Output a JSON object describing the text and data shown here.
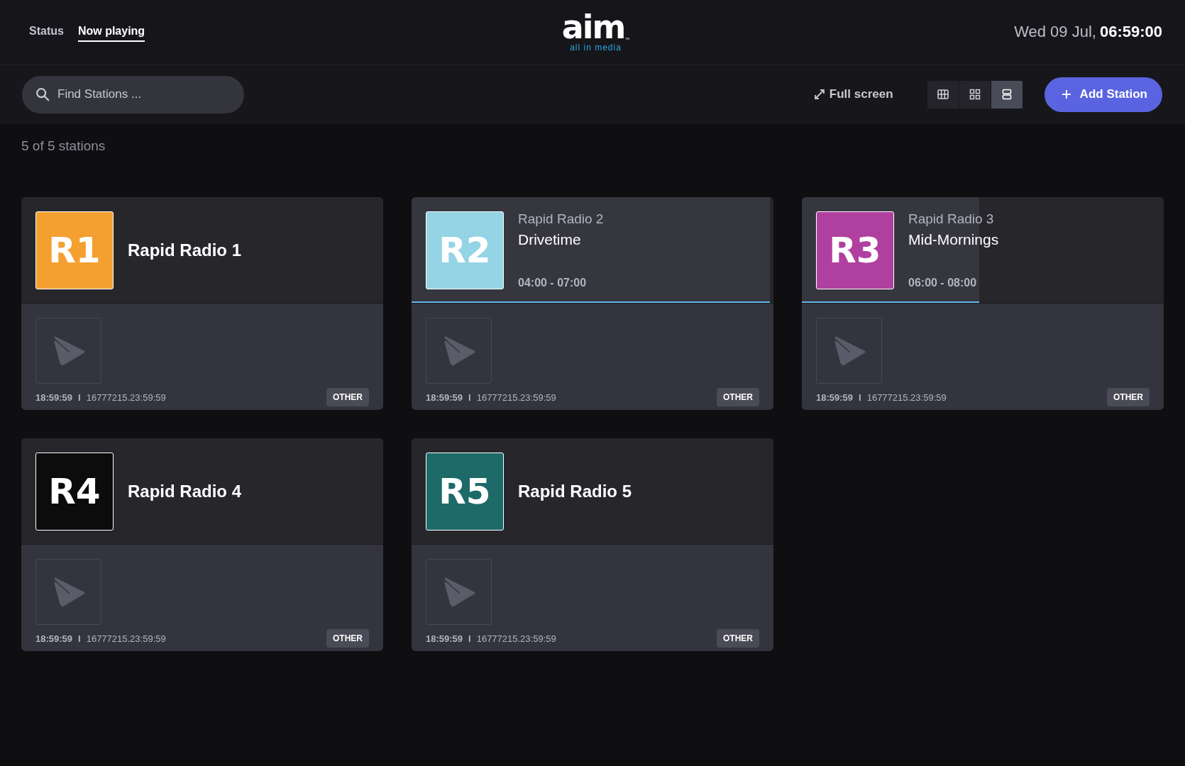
{
  "nav": {
    "tabs": [
      {
        "label": "Status",
        "selected": false
      },
      {
        "label": "Now playing",
        "selected": true
      }
    ]
  },
  "logo": {
    "wordmark": "aim",
    "trademark": "™",
    "tagline": "all in media"
  },
  "clock": {
    "date": "Wed 09 Jul,",
    "time": "06:59:00"
  },
  "toolbar": {
    "search": {
      "placeholder": "Find Stations ..."
    },
    "fullscreen": "Full screen",
    "views": [
      {
        "kind": "table",
        "selected": false
      },
      {
        "kind": "grid",
        "selected": false
      },
      {
        "kind": "list",
        "selected": true
      }
    ],
    "add_button": "Add Station"
  },
  "count": "5 of 5 stations",
  "stations": [
    {
      "badge": "R1",
      "color": "#f4a031",
      "name": "Rapid Radio 1",
      "footer_time": "18:59:59",
      "footer_sep": "I",
      "footer_duration": "16777215.23:59:59",
      "tag": "OTHER"
    },
    {
      "badge": "R2",
      "color": "#94d4e4",
      "name": "Rapid Radio 2",
      "show": {
        "title": "Drivetime",
        "hours": "04:00 - 07:00",
        "level": 0.99
      },
      "footer_time": "18:59:59",
      "footer_sep": "I",
      "footer_duration": "16777215.23:59:59",
      "tag": "OTHER"
    },
    {
      "badge": "R3",
      "color": "#b0409f",
      "name": "Rapid Radio 3",
      "show": {
        "title": "Mid-Mornings",
        "hours": "06:00 - 08:00",
        "level": 0.49
      },
      "footer_time": "18:59:59",
      "footer_sep": "I",
      "footer_duration": "16777215.23:59:59",
      "tag": "OTHER"
    },
    {
      "badge": "R4",
      "color": "#0c0c0c",
      "name": "Rapid Radio 4",
      "footer_time": "18:59:59",
      "footer_sep": "I",
      "footer_duration": "16777215.23:59:59",
      "tag": "OTHER"
    },
    {
      "badge": "R5",
      "color": "#1d6a69",
      "name": "Rapid Radio 5",
      "footer_time": "18:59:59",
      "footer_sep": "I",
      "footer_duration": "16777215.23:59:59",
      "tag": "OTHER"
    }
  ]
}
